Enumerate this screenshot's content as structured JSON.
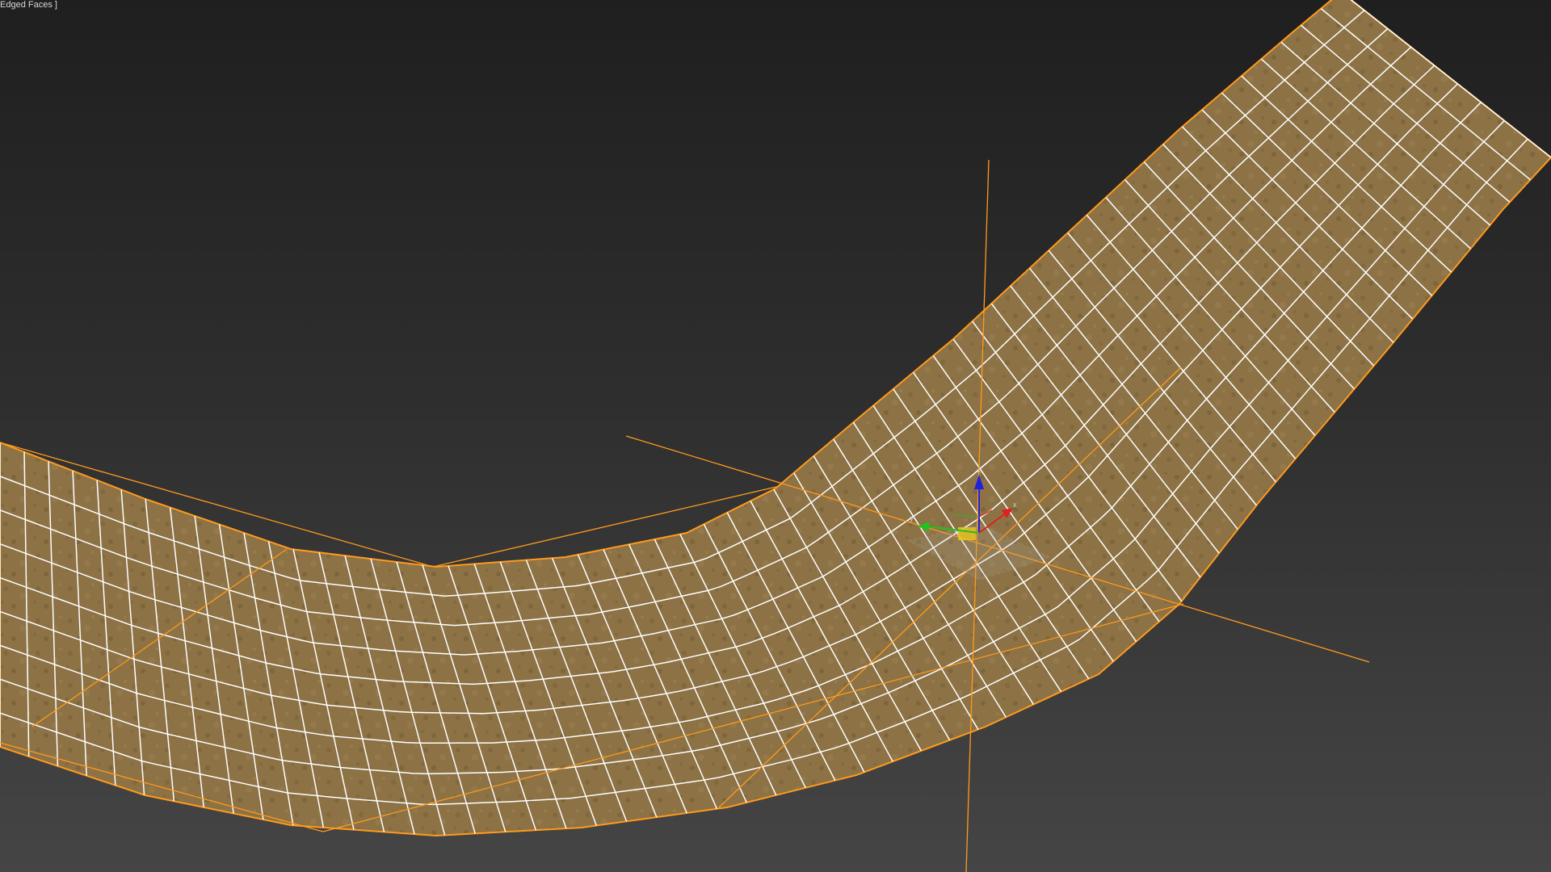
{
  "viewport": {
    "label": "Edged Faces ]",
    "display_mode": "Edged Faces"
  },
  "scene": {
    "object": "road-mesh",
    "selection_color": "#ff9a1e",
    "mesh_edge_color": "#ffffff",
    "material_color": "#8c7244"
  },
  "gizmo": {
    "x_label": "x",
    "y_label": "y",
    "z_label": "z",
    "x_color": "#e02020",
    "y_color": "#20c020",
    "z_color": "#2020e0"
  }
}
